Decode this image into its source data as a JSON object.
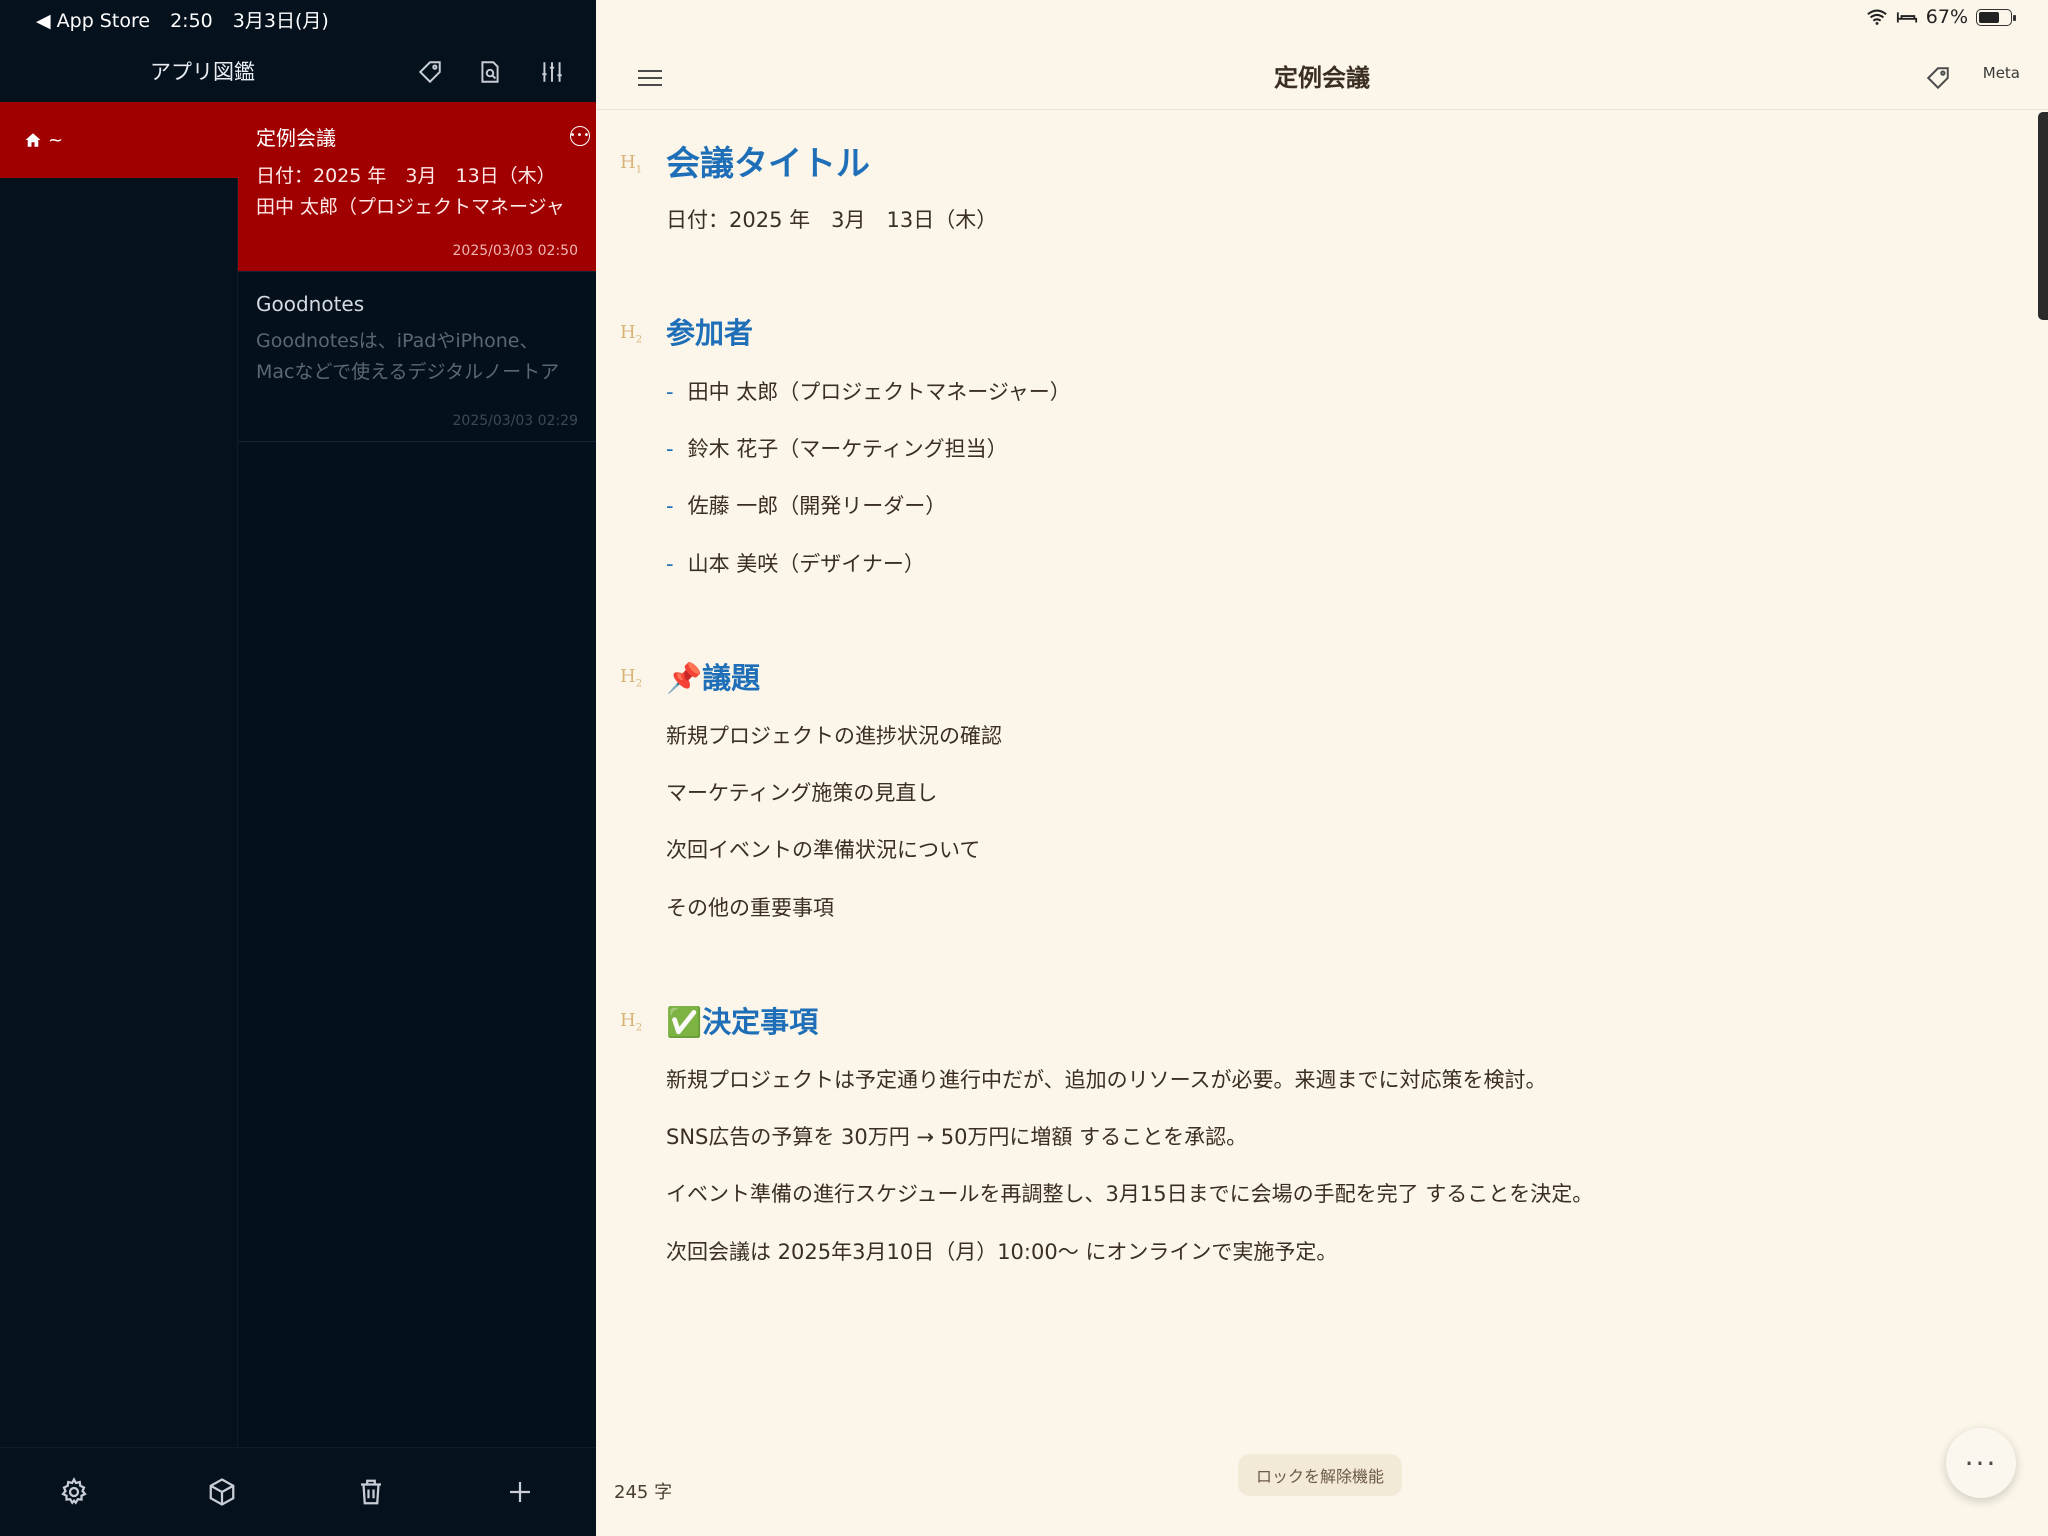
{
  "status_bar": {
    "back_label": "◀ App Store",
    "time": "2:50",
    "date": "3月3日(月)",
    "battery": "67%",
    "battery_level": 0.67
  },
  "sidebar": {
    "title": "アプリ図鑑",
    "header_icons": [
      "tag-icon",
      "search-document-icon",
      "sliders-icon"
    ],
    "folder": {
      "label": "~",
      "icon": "home-icon"
    },
    "notes": [
      {
        "title": "定例会議",
        "preview_lines": [
          "日付：2025 年　3月　13日（木）",
          "田中 太郎（プロジェクトマネージャ"
        ],
        "date": "2025/03/03 02:50",
        "selected": true
      },
      {
        "title": "Goodnotes",
        "preview_lines": [
          "Goodnotesは、iPadやiPhone、",
          "Macなどで使えるデジタルノートア"
        ],
        "date": "2025/03/03 02:29",
        "selected": false
      }
    ],
    "toolbar_icons": [
      "gear-icon",
      "box-icon",
      "trash-icon",
      "plus-icon"
    ]
  },
  "main": {
    "header_title": "定例会議",
    "meta_label": "Meta",
    "content": {
      "h1": {
        "marker": "H",
        "level": "1",
        "text": "会議タイトル"
      },
      "date_line": "日付：2025 年　3月　13日（木）",
      "participants_heading": {
        "marker": "H",
        "level": "2",
        "text": "参加者"
      },
      "participants": [
        "田中 太郎（プロジェクトマネージャー）",
        "鈴木 花子（マーケティング担当）",
        "佐藤 一郎（開発リーダー）",
        "山本 美咲（デザイナー）"
      ],
      "agenda_heading": {
        "marker": "H",
        "level": "2",
        "text": "📌議題"
      },
      "agenda": [
        "新規プロジェクトの進捗状況の確認",
        "マーケティング施策の見直し",
        "次回イベントの準備状況について",
        "その他の重要事項"
      ],
      "decisions_heading": {
        "marker": "H",
        "level": "2",
        "text": "✅決定事項"
      },
      "decisions": [
        "新規プロジェクトは予定通り進行中だが、追加のリソースが必要。来週までに対応策を検討。",
        "SNS広告の予算を 30万円 → 50万円に増額 することを承認。",
        "イベント準備の進行スケジュールを再調整し、3月15日までに会場の手配を完了 することを決定。",
        "次回会議は 2025年3月10日（月）10:00〜 にオンラインで実施予定。"
      ]
    },
    "char_count": "245 字",
    "unlock_label": "ロックを解除機能",
    "fab_label": "···"
  }
}
